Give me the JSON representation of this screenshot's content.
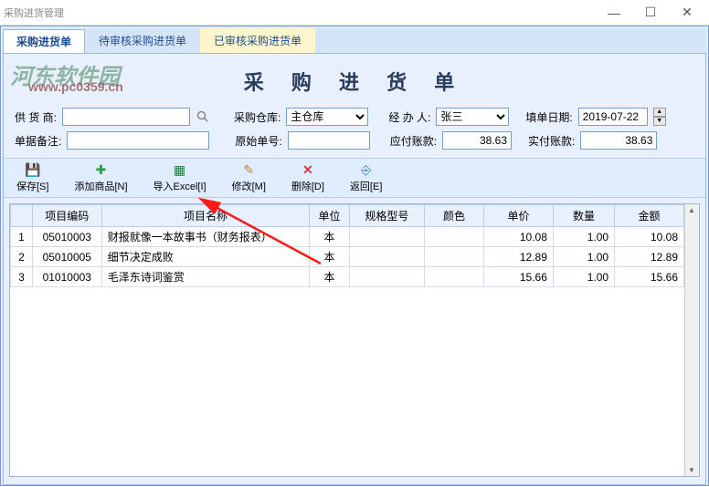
{
  "window": {
    "title": "采购进货管理",
    "min": "—",
    "max": "☐",
    "close": "✕"
  },
  "watermark": {
    "main": "河东软件园",
    "sub": "www.pc0359.cn"
  },
  "tabs": [
    {
      "label": "采购进货单",
      "active": true
    },
    {
      "label": "待审核采购进货单",
      "active": false
    },
    {
      "label": "已审核采购进货单",
      "active": false
    }
  ],
  "page_title": "采 购 进 货 单",
  "form": {
    "supplier_label": "供 货 商:",
    "supplier_value": "",
    "warehouse_label": "采购仓库:",
    "warehouse_value": "主仓库",
    "handler_label": "经 办 人:",
    "handler_value": "张三",
    "date_label": "填单日期:",
    "date_value": "2019-07-22",
    "remark_label": "单据备注:",
    "remark_value": "",
    "orig_no_label": "原始单号:",
    "orig_no_value": "",
    "payable_label": "应付账款:",
    "payable_value": "38.63",
    "paid_label": "实付账款:",
    "paid_value": "38.63"
  },
  "toolbar": {
    "save": "保存[S]",
    "add": "添加商品[N]",
    "import": "导入Excel[I]",
    "modify": "修改[M]",
    "delete": "删除[D]",
    "return": "返回[E]"
  },
  "columns": {
    "idx": "",
    "code": "项目编码",
    "name": "项目名称",
    "unit": "单位",
    "spec": "规格型号",
    "color": "颜色",
    "price": "单价",
    "qty": "数量",
    "amount": "金额"
  },
  "rows": [
    {
      "idx": "1",
      "code": "05010003",
      "name": "财报就像一本故事书（财务报表）",
      "unit": "本",
      "spec": "",
      "color": "",
      "price": "10.08",
      "qty": "1.00",
      "amount": "10.08"
    },
    {
      "idx": "2",
      "code": "05010005",
      "name": "细节决定成败",
      "unit": "本",
      "spec": "",
      "color": "",
      "price": "12.89",
      "qty": "1.00",
      "amount": "12.89"
    },
    {
      "idx": "3",
      "code": "01010003",
      "name": "毛泽东诗词鉴赏",
      "unit": "本",
      "spec": "",
      "color": "",
      "price": "15.66",
      "qty": "1.00",
      "amount": "15.66"
    }
  ]
}
